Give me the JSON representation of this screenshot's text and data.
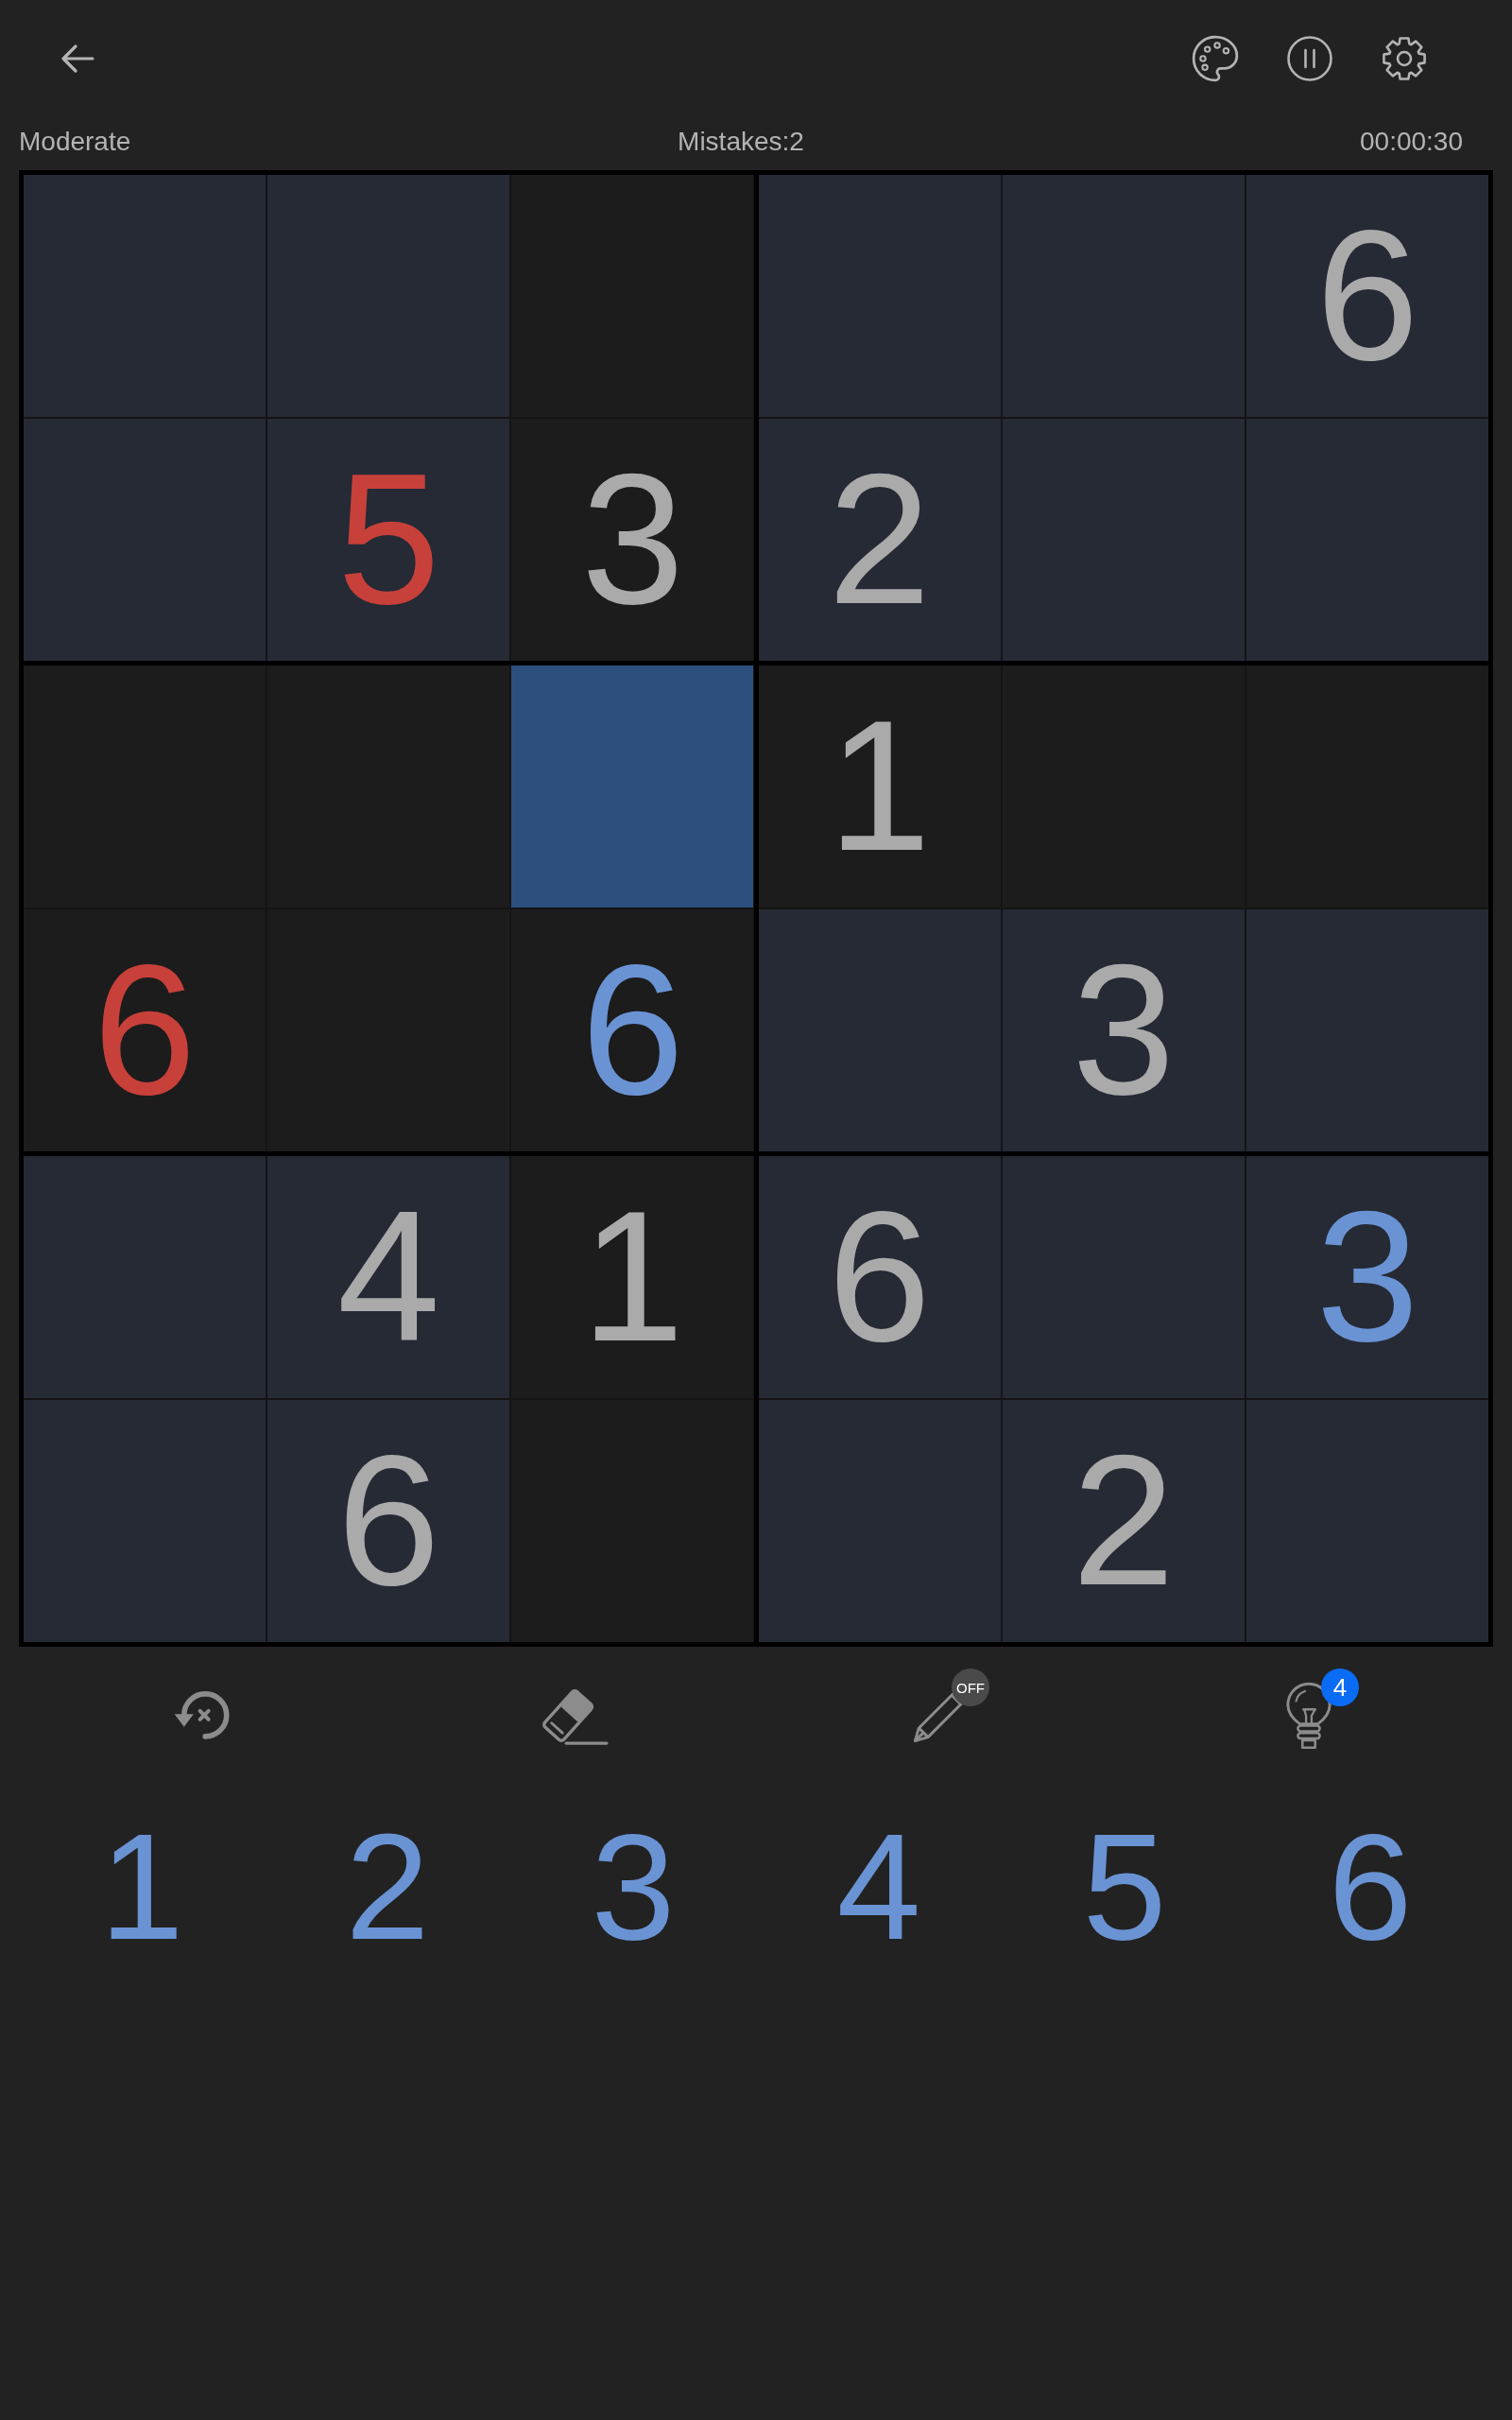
{
  "status_bar": {
    "difficulty": "Moderate",
    "mistakes": "Mistakes:2",
    "timer": "00:00:30"
  },
  "board": {
    "rows": [
      [
        {
          "kind": "empty",
          "highlighted": false,
          "selected": false
        },
        {
          "kind": "empty",
          "highlighted": false,
          "selected": false
        },
        {
          "kind": "empty",
          "highlighted": true,
          "selected": false
        },
        {
          "kind": "empty",
          "highlighted": false,
          "selected": false
        },
        {
          "kind": "empty",
          "highlighted": false,
          "selected": false
        },
        {
          "kind": "given",
          "value": "6",
          "highlighted": false,
          "selected": false
        }
      ],
      [
        {
          "kind": "empty",
          "highlighted": false,
          "selected": false
        },
        {
          "kind": "error",
          "value": "5",
          "highlighted": false,
          "selected": false
        },
        {
          "kind": "given",
          "value": "3",
          "highlighted": true,
          "selected": false
        },
        {
          "kind": "given",
          "value": "2",
          "highlighted": false,
          "selected": false
        },
        {
          "kind": "empty",
          "highlighted": false,
          "selected": false
        },
        {
          "kind": "empty",
          "highlighted": false,
          "selected": false
        }
      ],
      [
        {
          "kind": "empty",
          "highlighted": true,
          "selected": false
        },
        {
          "kind": "empty",
          "highlighted": true,
          "selected": false
        },
        {
          "kind": "empty",
          "highlighted": false,
          "selected": true
        },
        {
          "kind": "given",
          "value": "1",
          "highlighted": true,
          "selected": false
        },
        {
          "kind": "empty",
          "highlighted": true,
          "selected": false
        },
        {
          "kind": "empty",
          "highlighted": true,
          "selected": false
        }
      ],
      [
        {
          "kind": "error",
          "value": "6",
          "highlighted": true,
          "selected": false
        },
        {
          "kind": "empty",
          "highlighted": true,
          "selected": false
        },
        {
          "kind": "entered",
          "value": "6",
          "highlighted": true,
          "selected": false
        },
        {
          "kind": "empty",
          "highlighted": false,
          "selected": false
        },
        {
          "kind": "given",
          "value": "3",
          "highlighted": false,
          "selected": false
        },
        {
          "kind": "empty",
          "highlighted": false,
          "selected": false
        }
      ],
      [
        {
          "kind": "empty",
          "highlighted": false,
          "selected": false
        },
        {
          "kind": "given",
          "value": "4",
          "highlighted": false,
          "selected": false
        },
        {
          "kind": "given",
          "value": "1",
          "highlighted": true,
          "selected": false
        },
        {
          "kind": "given",
          "value": "6",
          "highlighted": false,
          "selected": false
        },
        {
          "kind": "empty",
          "highlighted": false,
          "selected": false
        },
        {
          "kind": "entered",
          "value": "3",
          "highlighted": false,
          "selected": false
        }
      ],
      [
        {
          "kind": "empty",
          "highlighted": false,
          "selected": false
        },
        {
          "kind": "given",
          "value": "6",
          "highlighted": false,
          "selected": false
        },
        {
          "kind": "empty",
          "highlighted": true,
          "selected": false
        },
        {
          "kind": "empty",
          "highlighted": false,
          "selected": false
        },
        {
          "kind": "given",
          "value": "2",
          "highlighted": false,
          "selected": false
        },
        {
          "kind": "empty",
          "highlighted": false,
          "selected": false
        }
      ]
    ]
  },
  "tools": [
    {
      "kind": "undo"
    },
    {
      "kind": "eraser"
    },
    {
      "kind": "pencil",
      "badge": "OFF"
    },
    {
      "kind": "hint",
      "badge": "4"
    }
  ],
  "number_pad": [
    "1",
    "2",
    "3",
    "4",
    "5",
    "6"
  ]
}
